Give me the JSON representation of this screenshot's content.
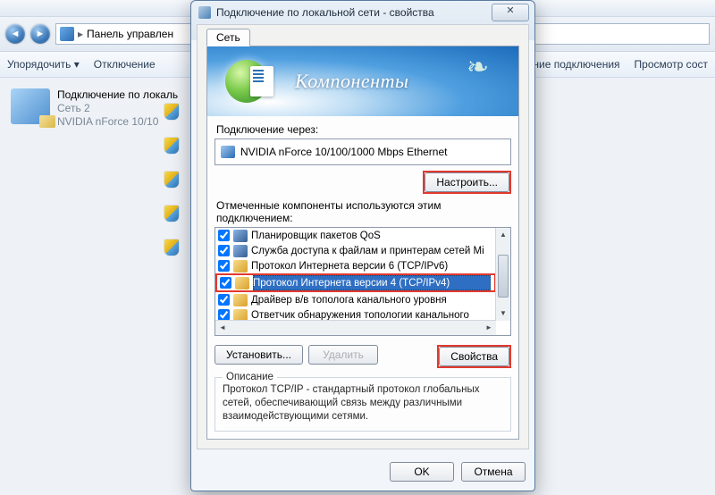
{
  "parent": {
    "breadcrumb_text": "Панель управлен",
    "toolbar": {
      "organize": "Упорядочить ▾",
      "disable": "Отключение",
      "diagnose": "вание подключения",
      "view": "Просмотр сост"
    },
    "net_item": {
      "title": "Подключение по локаль",
      "line2": "Сеть 2",
      "line3": "NVIDIA nForce 10/10"
    }
  },
  "dialog": {
    "title": "Подключение по локальной сети - свойства",
    "tab": "Сеть",
    "hero": "Компоненты",
    "connect_via_label": "Подключение через:",
    "adapter": "NVIDIA nForce 10/100/1000 Mbps Ethernet",
    "configure": "Настроить...",
    "components_label": "Отмеченные компоненты используются этим подключением:",
    "items": [
      "Планировщик пакетов QoS",
      "Служба доступа к файлам и принтерам сетей Mi",
      "Протокол Интернета версии 6 (TCP/IPv6)",
      "Протокол Интернета версии 4 (TCP/IPv4)",
      "Драйвер в/в тополога канального уровня",
      "Ответчик обнаружения топологии канального"
    ],
    "install": "Установить...",
    "uninstall": "Удалить",
    "properties": "Свойства",
    "desc_legend": "Описание",
    "desc_text": "Протокол TCP/IP - стандартный протокол глобальных сетей, обеспечивающий связь между различными взаимодействующими сетями.",
    "ok": "OK",
    "cancel": "Отмена"
  }
}
